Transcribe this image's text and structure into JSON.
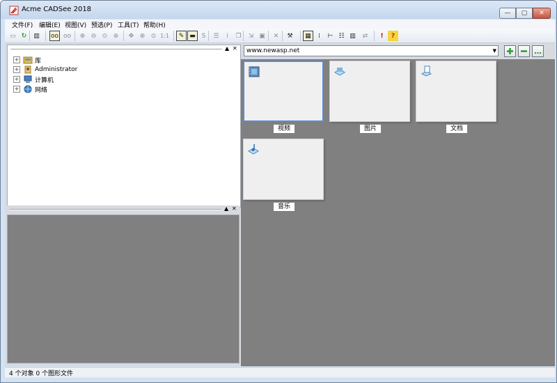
{
  "window": {
    "title": "Acme CADSee 2018",
    "controls": {
      "minimize": "—",
      "maximize": "▢",
      "close": "✕"
    }
  },
  "menu": [
    "文件(F)",
    "编辑(E)",
    "视图(V)",
    "预选(P)",
    "工具(T)",
    "帮助(H)"
  ],
  "toolbar_buttons": [
    {
      "name": "open-icon",
      "glyph": "▭"
    },
    {
      "name": "refresh-icon",
      "glyph": "↻"
    },
    {
      "name": "panel-icon",
      "glyph": "▥"
    },
    {
      "name": "view-glasses-icon",
      "glyph": "oo"
    },
    {
      "name": "view-glasses2-icon",
      "glyph": "oo"
    },
    {
      "name": "zoom-in-icon",
      "glyph": "⊕"
    },
    {
      "name": "zoom-out-icon",
      "glyph": "⊖"
    },
    {
      "name": "zoom-window-icon",
      "glyph": "⊙"
    },
    {
      "name": "zoom-extents-icon",
      "glyph": "⊛"
    },
    {
      "name": "pan-icon",
      "glyph": "✥"
    },
    {
      "name": "zoom-all-icon",
      "glyph": "⊕"
    },
    {
      "name": "zoom-realtime-icon",
      "glyph": "⊙"
    },
    {
      "name": "actual-size-icon",
      "glyph": "1:1"
    },
    {
      "name": "regen-icon",
      "glyph": "✎"
    },
    {
      "name": "measure-icon",
      "glyph": "▬"
    },
    {
      "name": "s-icon",
      "glyph": "S"
    },
    {
      "name": "layers-icon",
      "glyph": "☰"
    },
    {
      "name": "info-icon",
      "glyph": "i"
    },
    {
      "name": "copy-icon",
      "glyph": "❐"
    },
    {
      "name": "export-icon",
      "glyph": "⇲"
    },
    {
      "name": "paste-icon",
      "glyph": "▣"
    },
    {
      "name": "delete-icon",
      "glyph": "✕"
    },
    {
      "name": "tool-icon",
      "glyph": "⚒"
    },
    {
      "name": "thumbnails-view-icon",
      "glyph": "▦"
    },
    {
      "name": "list-view-icon",
      "glyph": "⁞"
    },
    {
      "name": "tree-view-icon",
      "glyph": "⊢"
    },
    {
      "name": "details-view-icon",
      "glyph": "☷"
    },
    {
      "name": "columns-view-icon",
      "glyph": "▥"
    },
    {
      "name": "sync-icon",
      "glyph": "⇄"
    },
    {
      "name": "alert-icon",
      "glyph": "!"
    },
    {
      "name": "help-icon",
      "glyph": "?"
    }
  ],
  "tree": [
    {
      "label": "库",
      "icon": "library-icon",
      "color": "#e5b84c"
    },
    {
      "label": "Administrator",
      "icon": "user-icon",
      "color": "#c89a3a"
    },
    {
      "label": "计算机",
      "icon": "computer-icon",
      "color": "#4a7fc1"
    },
    {
      "label": "网络",
      "icon": "network-icon",
      "color": "#3f86c7"
    }
  ],
  "address": {
    "value": "www.newasp.net"
  },
  "folders": [
    {
      "label": "视频",
      "icon": "video-folder-icon",
      "selected": true
    },
    {
      "label": "图片",
      "icon": "picture-folder-icon",
      "selected": false
    },
    {
      "label": "文档",
      "icon": "document-folder-icon",
      "selected": false
    },
    {
      "label": "音乐",
      "icon": "music-folder-icon",
      "selected": false
    }
  ],
  "pane_header": {
    "up": "▲",
    "close": "✕"
  },
  "status": {
    "text": "4 个对象 0 个图形文件"
  },
  "colors": {
    "browser_bg": "#808080",
    "selected_border": "#5a8ad1",
    "add_green": "#2e9a2e"
  }
}
